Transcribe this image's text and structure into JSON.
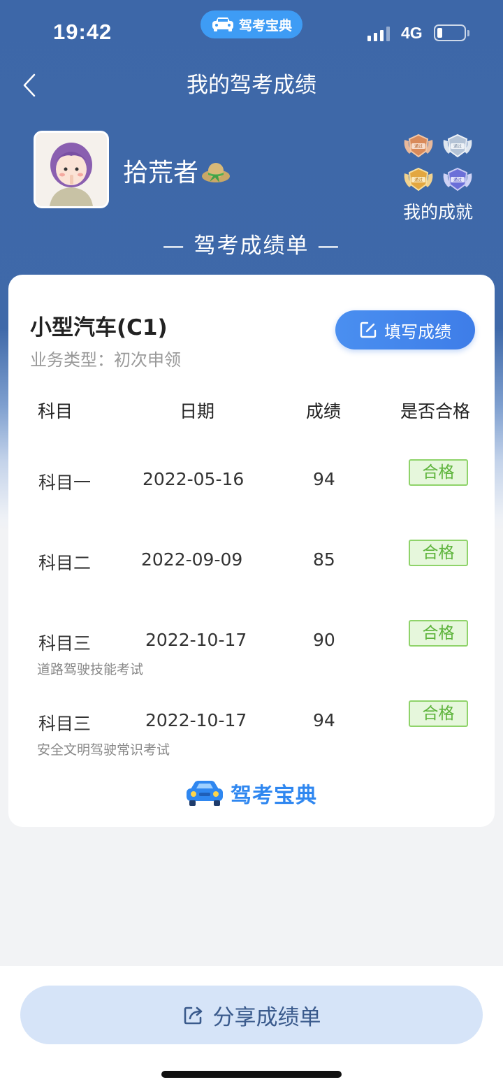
{
  "status_bar": {
    "time": "19:42",
    "app_badge": "驾考宝典",
    "network": "4G"
  },
  "nav": {
    "title": "我的驾考成绩",
    "back_icon": "chevron-left-icon"
  },
  "profile": {
    "username": "拾荒者",
    "achievements_label": "我的成就"
  },
  "sheet_title": "— 驾考成绩单 —",
  "card": {
    "car_type": "小型汽车(C1)",
    "business_type": "业务类型：初次申领",
    "fill_button_label": "填写成绩",
    "headers": {
      "subject": "科目",
      "date": "日期",
      "score": "成绩",
      "passed": "是否合格"
    },
    "rows": [
      {
        "subject": "科目一",
        "date": "2022-05-16",
        "score": "94",
        "status": "合格",
        "note": ""
      },
      {
        "subject": "科目二",
        "date": "2022-09-09",
        "score": "85",
        "status": "合格",
        "note": ""
      },
      {
        "subject": "科目三",
        "date": "2022-10-17",
        "score": "90",
        "status": "合格",
        "note": "道路驾驶技能考试"
      },
      {
        "subject": "科目三",
        "date": "2022-10-17",
        "score": "94",
        "status": "合格",
        "note": "安全文明驾驶常识考试"
      }
    ],
    "brand": "驾考宝典"
  },
  "share_button_label": "分享成绩单",
  "colors": {
    "header_blue": "#3d67a8",
    "button_blue": "#3e7de8",
    "pass_green": "#5cb33a",
    "brand_blue": "#2f87f0"
  }
}
